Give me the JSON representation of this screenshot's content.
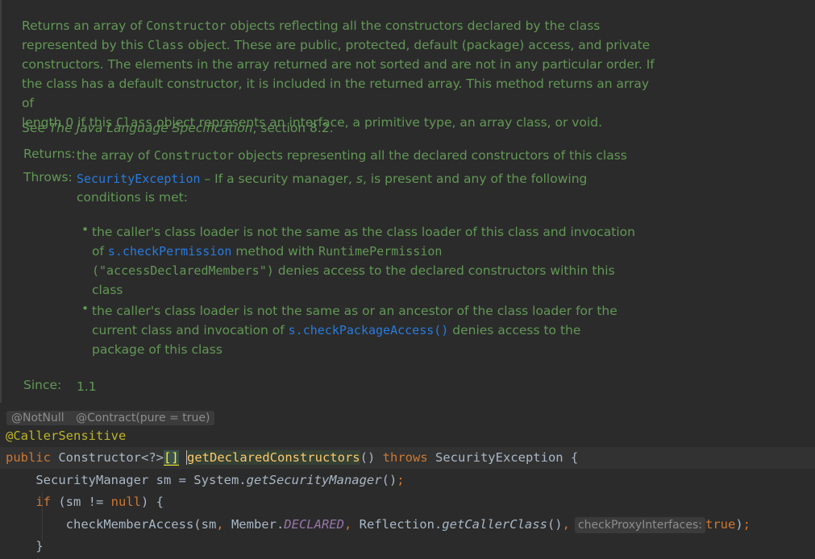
{
  "doc": {
    "p1": [
      {
        "t": "Returns an array of "
      },
      {
        "t": "Constructor",
        "m": true
      },
      {
        "t": " objects reflecting all the constructors declared by the class"
      }
    ],
    "p1_l2": [
      {
        "t": "represented by this "
      },
      {
        "t": "Class",
        "m": true
      },
      {
        "t": " object. These are public, protected, default (package) access, and private"
      }
    ],
    "p1_l3": "constructors. The elements in the array returned are not sorted and are not in any particular order. If",
    "p1_l4": "the class has a default constructor, it is included in the returned array. This method returns an array of",
    "p1_l5": [
      {
        "t": "length 0 if this "
      },
      {
        "t": "Class",
        "m": true
      },
      {
        "t": " object represents an interface, a primitive type, an array class, or void."
      }
    ],
    "see_prefix": "See ",
    "see_title": "The Java Language Specification",
    "see_suffix": ", section 8.2.",
    "returns_label": "Returns:",
    "returns_text_a": "the array of ",
    "returns_text_m": "Constructor",
    "returns_text_b": " objects representing all the declared constructors of this class",
    "throws_label": "Throws:",
    "throws_link": "SecurityException",
    "throws_text_a": " – If a security manager, ",
    "throws_text_s": "s",
    "throws_text_b": ", is present and any of the following",
    "throws_text_l2": "conditions is met:",
    "bullet_char": "•",
    "b1_l1": "the caller's class loader is not the same as the class loader of this class and invocation",
    "b1_l2_a": "of ",
    "b1_l2_link": "s.checkPermission",
    "b1_l2_b": " method with ",
    "b1_l2_m": "RuntimePermission",
    "b1_l3_m": "(\"accessDeclaredMembers\")",
    "b1_l3_b": " denies access to the declared constructors within this",
    "b1_l4": "class",
    "b2_l1": "the caller's class loader is not the same as or an ancestor of the class loader for the",
    "b2_l2_a": "current class and invocation of ",
    "b2_l2_link": "s.checkPackageAccess()",
    "b2_l2_b": " denies access to the",
    "b2_l3": "package of this class",
    "since_label": "Since:",
    "since_value": "1.1"
  },
  "hints": {
    "notnull": "@NotNull",
    "contract": "@Contract(pure = true)"
  },
  "code": {
    "annotation": "@CallerSensitive",
    "l2_public": "public",
    "l2_type": " Constructor<?>",
    "l2_brackets": "[]",
    "l2_space": " ",
    "l2_method": "getDeclaredConstructors",
    "l2_parens": "()",
    "l2_throws": "throws",
    "l2_exc": " SecurityException {",
    "l3_a": "    SecurityManager sm = System.",
    "l3_call": "getSecurityManager",
    "l3_b": "()",
    "l3_semi": ";",
    "l4_if": "if",
    "l4_a": " (sm != ",
    "l4_null": "null",
    "l4_b": ") {",
    "l5_a": "        checkMemberAccess(sm",
    "l5_comma1": ",",
    "l5_b": " Member.",
    "l5_static": "DECLARED",
    "l5_comma2": ",",
    "l5_c": " Reflection.",
    "l5_call": "getCallerClass",
    "l5_d": "()",
    "l5_comma3": ",",
    "l5_hint": "checkProxyInterfaces:",
    "l5_true": "true",
    "l5_e": ")",
    "l5_semi": ";",
    "l6": "    }"
  }
}
